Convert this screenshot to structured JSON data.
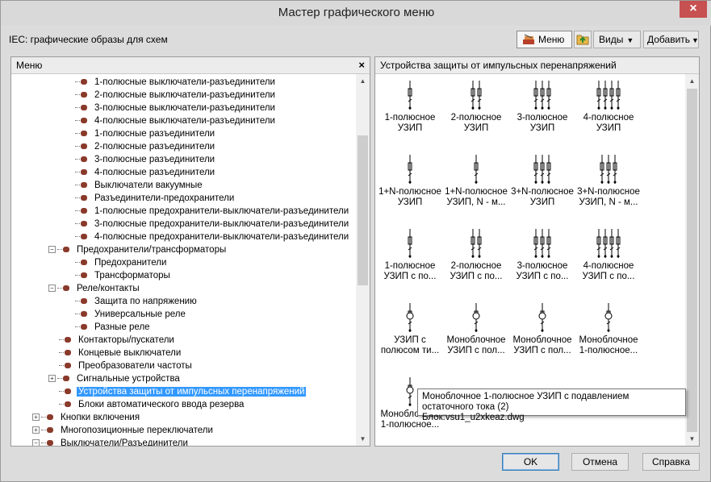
{
  "window": {
    "title": "Мастер графического меню",
    "close_glyph": "×"
  },
  "subtitle": "IEC: графические образы для схем",
  "toolbar": {
    "menu_label": "Меню",
    "views_label": "Виды",
    "add_label": "Добавить"
  },
  "left_panel": {
    "header": "Меню",
    "close_glyph": "×",
    "items": [
      {
        "label": "1-полюсные выключатели-разъединители",
        "level": 3,
        "expander": ""
      },
      {
        "label": "2-полюсные выключатели-разъединители",
        "level": 3,
        "expander": ""
      },
      {
        "label": "3-полюсные выключатели-разъединители",
        "level": 3,
        "expander": ""
      },
      {
        "label": "4-полюсные выключатели-разъединители",
        "level": 3,
        "expander": ""
      },
      {
        "label": "1-полюсные разъединители",
        "level": 3,
        "expander": ""
      },
      {
        "label": "2-полюсные разъединители",
        "level": 3,
        "expander": ""
      },
      {
        "label": "3-полюсные разъединители",
        "level": 3,
        "expander": ""
      },
      {
        "label": "4-полюсные разъединители",
        "level": 3,
        "expander": ""
      },
      {
        "label": "Выключатели вакуумные",
        "level": 3,
        "expander": ""
      },
      {
        "label": "Разъединители-предохранители",
        "level": 3,
        "expander": ""
      },
      {
        "label": "1-полюсные предохранители-выключатели-разъединители",
        "level": 3,
        "expander": ""
      },
      {
        "label": "3-полюсные предохранители-выключатели-разъединители",
        "level": 3,
        "expander": ""
      },
      {
        "label": "4-полюсные предохранители-выключатели-разъединители",
        "level": 3,
        "expander": ""
      },
      {
        "label": "Предохранители/трансформаторы",
        "level": 2,
        "expander": "−"
      },
      {
        "label": "Предохранители",
        "level": 3,
        "expander": ""
      },
      {
        "label": "Трансформаторы",
        "level": 3,
        "expander": ""
      },
      {
        "label": "Реле/контакты",
        "level": 2,
        "expander": "−"
      },
      {
        "label": "Защита по напряжению",
        "level": 3,
        "expander": ""
      },
      {
        "label": "Универсальные реле",
        "level": 3,
        "expander": ""
      },
      {
        "label": "Разные реле",
        "level": 3,
        "expander": ""
      },
      {
        "label": "Контакторы/пускатели",
        "level": 2,
        "expander": ""
      },
      {
        "label": "Концевые выключатели",
        "level": 2,
        "expander": ""
      },
      {
        "label": "Преобразователи частоты",
        "level": 2,
        "expander": ""
      },
      {
        "label": "Сигнальные устройства",
        "level": 2,
        "expander": "+"
      },
      {
        "label": "Устройства защиты от импульсных перенапряжений",
        "level": 2,
        "expander": "",
        "selected": true
      },
      {
        "label": "Блоки автоматического ввода резерва",
        "level": 2,
        "expander": ""
      },
      {
        "label": "Кнопки включения",
        "level": 1,
        "expander": "+"
      },
      {
        "label": "Многопозиционные переключатели",
        "level": 1,
        "expander": "+"
      },
      {
        "label": "Выключатели/Разъединители",
        "level": 1,
        "expander": "−"
      }
    ]
  },
  "right_panel": {
    "header": "Устройства защиты от импульсных перенапряжений",
    "items": [
      {
        "line1": "1-полюсное",
        "line2": "УЗИП",
        "icon": "spd-1p-icon"
      },
      {
        "line1": "2-полюсное",
        "line2": "УЗИП",
        "icon": "spd-2p-icon"
      },
      {
        "line1": "3-полюсное",
        "line2": "УЗИП",
        "icon": "spd-3p-icon"
      },
      {
        "line1": "4-полюсное",
        "line2": "УЗИП",
        "icon": "spd-4p-icon"
      },
      {
        "line1": "1+N-полюсное",
        "line2": "УЗИП",
        "icon": "spd-1pn-icon"
      },
      {
        "line1": "1+N-полюсное",
        "line2": "УЗИП, N - м...",
        "icon": "spd-1pn-m-icon"
      },
      {
        "line1": "3+N-полюсное",
        "line2": "УЗИП",
        "icon": "spd-3pn-icon"
      },
      {
        "line1": "3+N-полюсное",
        "line2": "УЗИП, N - м...",
        "icon": "spd-3pn-m-icon"
      },
      {
        "line1": "1-полюсное",
        "line2": "УЗИП с по...",
        "icon": "spd-1p-s-icon"
      },
      {
        "line1": "2-полюсное",
        "line2": "УЗИП с по...",
        "icon": "spd-2p-s-icon"
      },
      {
        "line1": "3-полюсное",
        "line2": "УЗИП с по...",
        "icon": "spd-3p-s-icon"
      },
      {
        "line1": "4-полюсное",
        "line2": "УЗИП с по...",
        "icon": "spd-4p-s-icon"
      },
      {
        "line1": "УЗИП с",
        "line2": "полюсом ти...",
        "icon": "spd-pole-icon"
      },
      {
        "line1": "Моноблочное",
        "line2": "УЗИП с пол...",
        "icon": "spd-mono-icon"
      },
      {
        "line1": "Моноблочное",
        "line2": "УЗИП с пол...",
        "icon": "spd-mono2-icon"
      },
      {
        "line1": "Моноблочное",
        "line2": "1-полюсное...",
        "icon": "spd-mono-1p-icon"
      },
      {
        "line1": "Моноблочное",
        "line2": "1-полюсное...",
        "icon": "spd-mono-1p-r-icon"
      }
    ]
  },
  "tooltip": {
    "line1": "Моноблочное 1-полюсное УЗИП с подавлением остаточного тока (2)",
    "line2": "Блок:vsu1_u2xkeaz.dwg"
  },
  "buttons": {
    "ok": "OK",
    "cancel": "Отмена",
    "help": "Справка"
  }
}
